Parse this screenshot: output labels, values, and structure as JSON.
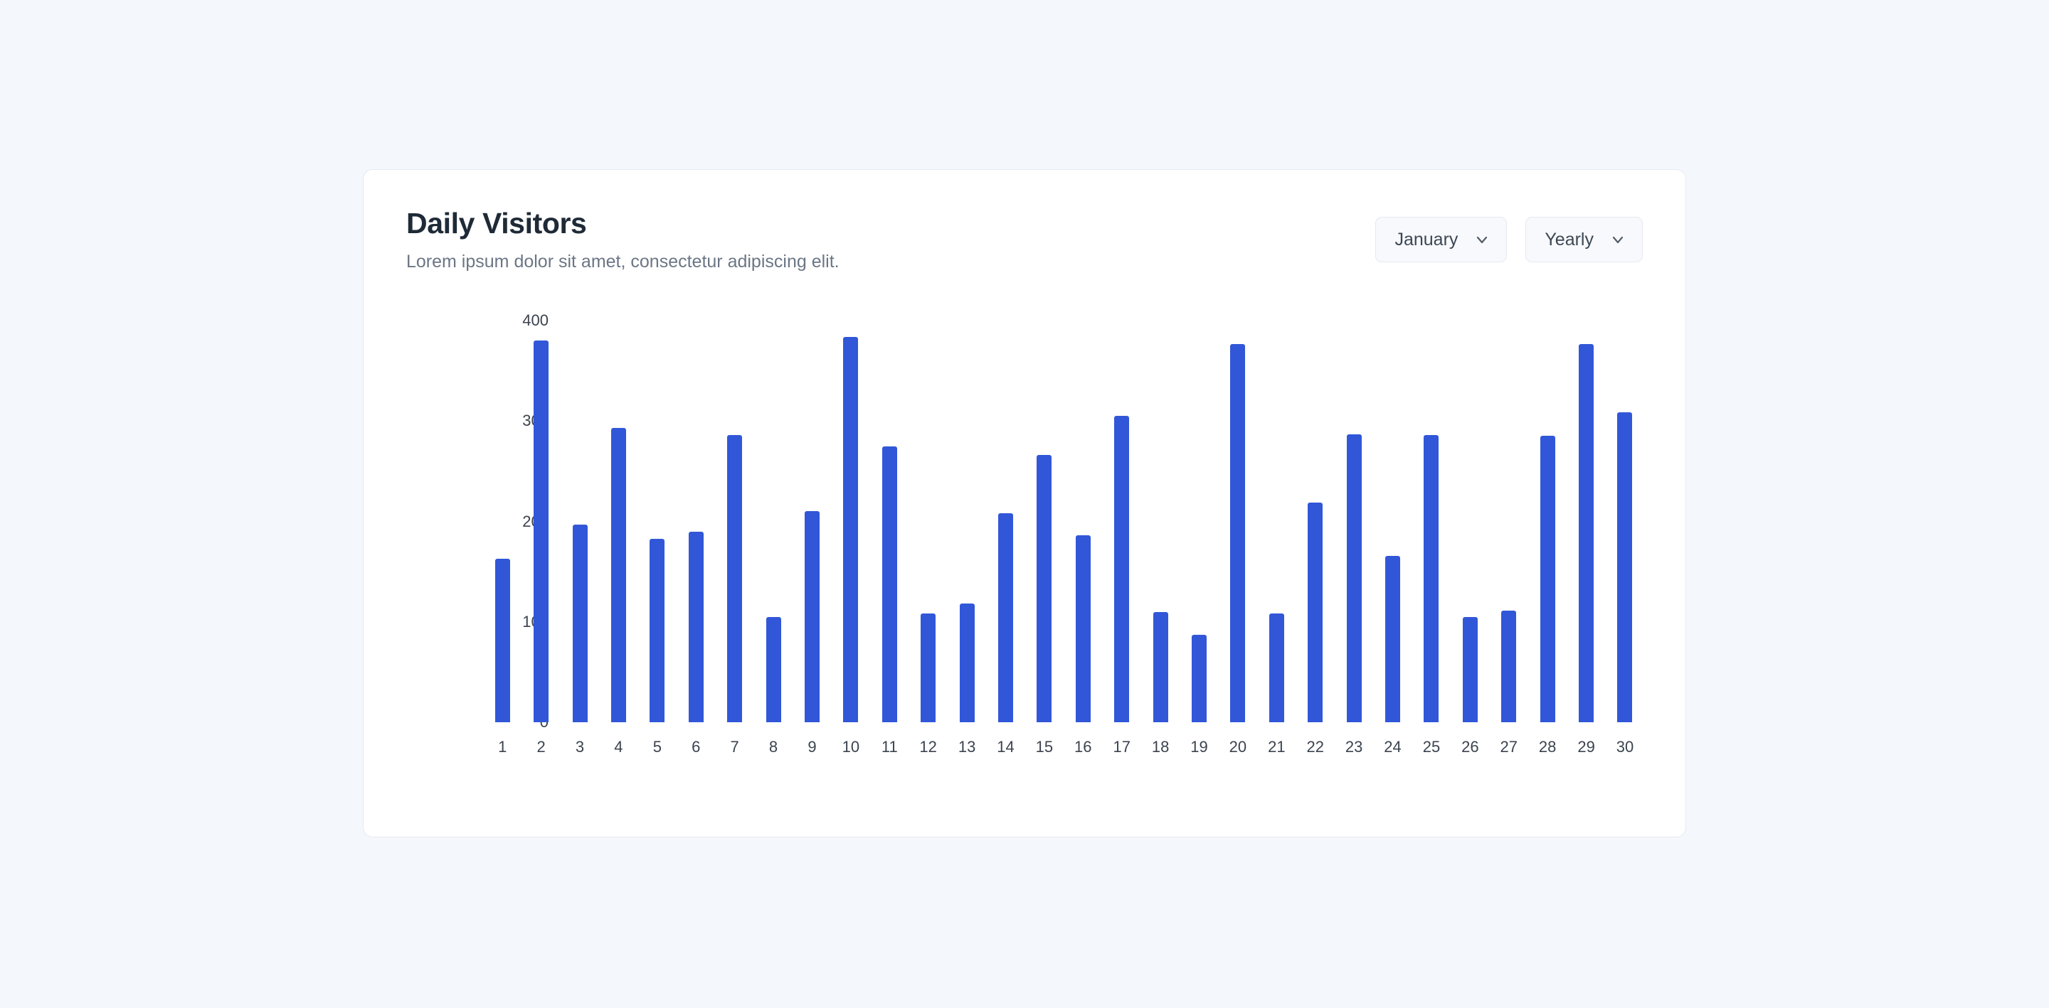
{
  "card": {
    "title": "Daily Visitors",
    "subtitle": "Lorem ipsum dolor sit amet, consectetur adipiscing elit."
  },
  "controls": {
    "month_select": {
      "value": "January",
      "icon": "chevron-down-icon"
    },
    "period_select": {
      "value": "Yearly",
      "icon": "chevron-down-icon"
    }
  },
  "colors": {
    "bar": "#3157d8",
    "page_background": "#f4f7fb",
    "card_background": "#ffffff",
    "card_border": "#e6e9ef",
    "title_text": "#1f2a37",
    "subtitle_text": "#6b7685",
    "axis_text": "#3b434f",
    "control_background": "#f7f9fc"
  },
  "chart_data": {
    "type": "bar",
    "title": "Daily Visitors",
    "subtitle": "Lorem ipsum dolor sit amet, consectetur adipiscing elit.",
    "xlabel": "",
    "ylabel": "",
    "ylim": [
      0,
      400
    ],
    "yticks": [
      0,
      100,
      200,
      300,
      400
    ],
    "ytick_labels": [
      "0",
      "100",
      "200",
      "300",
      "400"
    ],
    "grid": false,
    "legend": false,
    "categories": [
      "1",
      "2",
      "3",
      "4",
      "5",
      "6",
      "7",
      "8",
      "9",
      "10",
      "11",
      "12",
      "13",
      "14",
      "15",
      "16",
      "17",
      "18",
      "19",
      "20",
      "21",
      "22",
      "23",
      "24",
      "25",
      "26",
      "27",
      "28",
      "29",
      "30"
    ],
    "values": [
      163,
      380,
      197,
      293,
      183,
      190,
      286,
      105,
      210,
      384,
      275,
      108,
      118,
      208,
      266,
      186,
      305,
      110,
      87,
      377,
      108,
      219,
      287,
      166,
      286,
      105,
      111,
      285,
      377,
      309
    ]
  }
}
